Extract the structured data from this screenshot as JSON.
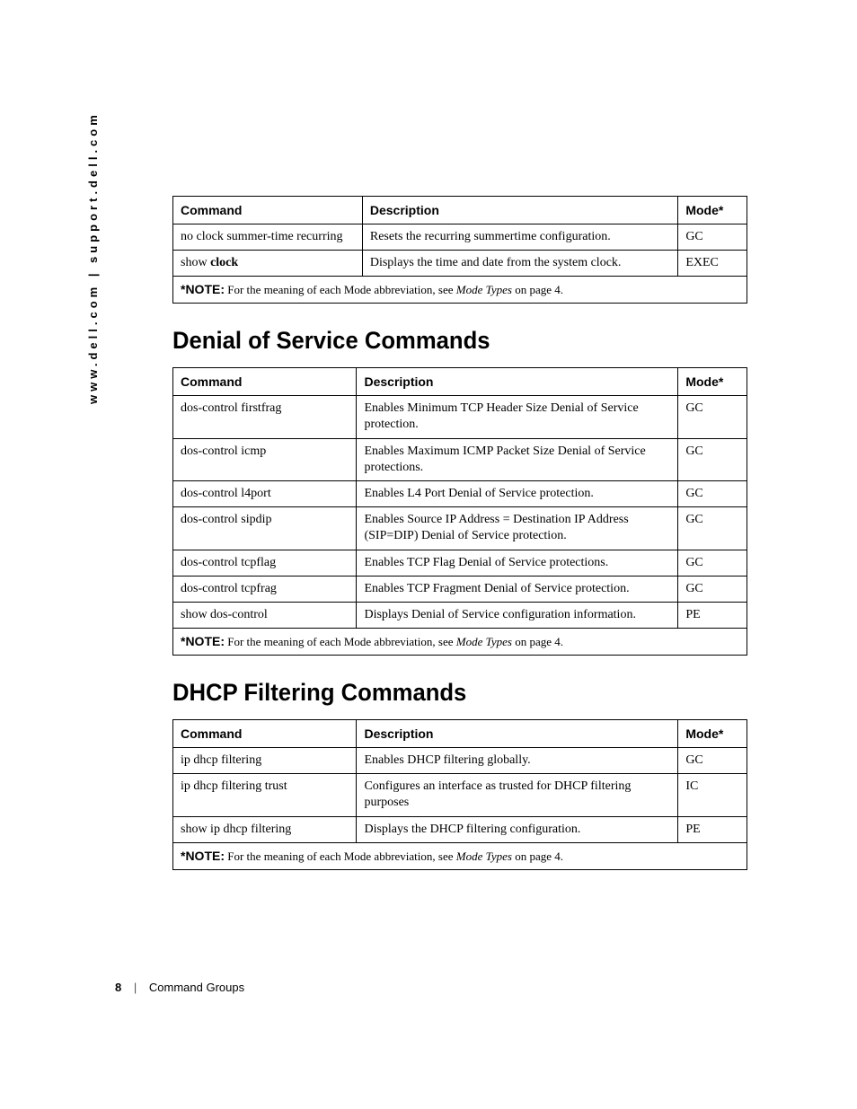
{
  "side_url": "www.dell.com | support.dell.com",
  "headers": {
    "command": "Command",
    "description": "Description",
    "mode": "Mode*"
  },
  "note": {
    "label": "*NOTE:",
    "prefix": " For the meaning of each Mode abbreviation, see ",
    "italic": "Mode Types",
    "suffix": " on page 4."
  },
  "section0": {
    "rows": [
      {
        "cmd_pre": "no clock summer-time recurring",
        "cmd_bold": "",
        "desc": "Resets the recurring summertime configuration.",
        "mode": "GC"
      },
      {
        "cmd_pre": "show ",
        "cmd_bold": "clock",
        "desc": "Displays the time and date from the system clock.",
        "mode": "EXEC"
      }
    ]
  },
  "section1": {
    "title": "Denial of Service Commands",
    "rows": [
      {
        "cmd": "dos-control firstfrag",
        "desc": "Enables Minimum TCP Header Size Denial of Service protection.",
        "mode": "GC"
      },
      {
        "cmd": "dos-control icmp",
        "desc": "Enables Maximum ICMP Packet Size Denial of Service protections.",
        "mode": "GC"
      },
      {
        "cmd": "dos-control l4port",
        "desc": "Enables L4 Port Denial of Service protection.",
        "mode": "GC"
      },
      {
        "cmd": "dos-control sipdip",
        "desc": "Enables Source IP Address = Destination IP Address (SIP=DIP) Denial of Service protection.",
        "mode": "GC"
      },
      {
        "cmd": "dos-control tcpflag",
        "desc": "Enables TCP Flag Denial of Service protections.",
        "mode": "GC"
      },
      {
        "cmd": "dos-control tcpfrag",
        "desc": "Enables TCP Fragment Denial of Service protection.",
        "mode": "GC"
      },
      {
        "cmd": "show dos-control",
        "desc": "Displays Denial of Service configuration information.",
        "mode": "PE"
      }
    ]
  },
  "section2": {
    "title": "DHCP Filtering Commands",
    "rows": [
      {
        "cmd": "ip dhcp filtering",
        "desc": "Enables DHCP filtering globally.",
        "mode": "GC"
      },
      {
        "cmd": "ip dhcp filtering trust",
        "desc": "Configures an interface as trusted for DHCP filtering purposes",
        "mode": "IC"
      },
      {
        "cmd": "show ip dhcp filtering",
        "desc": "Displays the DHCP filtering configuration.",
        "mode": "PE"
      }
    ]
  },
  "footer": {
    "page": "8",
    "title": "Command Groups"
  }
}
